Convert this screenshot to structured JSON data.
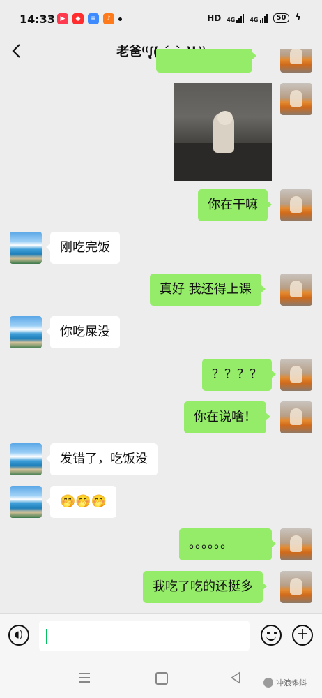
{
  "status_bar": {
    "time": "14:33",
    "apps": [
      {
        "icon": "video-app-icon",
        "color": "#ff3a4f"
      },
      {
        "icon": "shop-app-icon",
        "color": "#ff2d2d"
      },
      {
        "icon": "wallet-app-icon",
        "color": "#3d8bff"
      },
      {
        "icon": "listen-app-icon",
        "color": "#ff7a1a"
      }
    ],
    "hd": "HD",
    "net1": "4G",
    "net2": "4G",
    "battery": "50"
  },
  "header": {
    "title": "老爸⁽⁽ᶘ( ˊᵕˋ )ᶅ⁾⁾"
  },
  "messages": [
    {
      "from": "me",
      "type": "text",
      "text": ""
    },
    {
      "from": "me",
      "type": "image",
      "text": ""
    },
    {
      "from": "me",
      "type": "text",
      "text": "你在干嘛"
    },
    {
      "from": "other",
      "type": "text",
      "text": "刚吃完饭"
    },
    {
      "from": "me",
      "type": "text",
      "text": "真好 我还得上课"
    },
    {
      "from": "other",
      "type": "text",
      "text": "你吃屎没"
    },
    {
      "from": "me",
      "type": "text",
      "text": "？？？？"
    },
    {
      "from": "me",
      "type": "text",
      "text": "你在说啥！"
    },
    {
      "from": "other",
      "type": "text",
      "text": "发错了，吃饭没"
    },
    {
      "from": "other",
      "type": "text",
      "text": "🤭🤭🤭"
    },
    {
      "from": "me",
      "type": "text",
      "text": "。。。。。。"
    },
    {
      "from": "me",
      "type": "text",
      "text": "我吃了吃的还挺多"
    }
  ],
  "input": {
    "value": ""
  },
  "watermark": "冲浪蝌蚪",
  "colors": {
    "my_bubble": "#95ec69",
    "other_bubble": "#ffffff",
    "background": "#ededed",
    "caret": "#07c160"
  }
}
